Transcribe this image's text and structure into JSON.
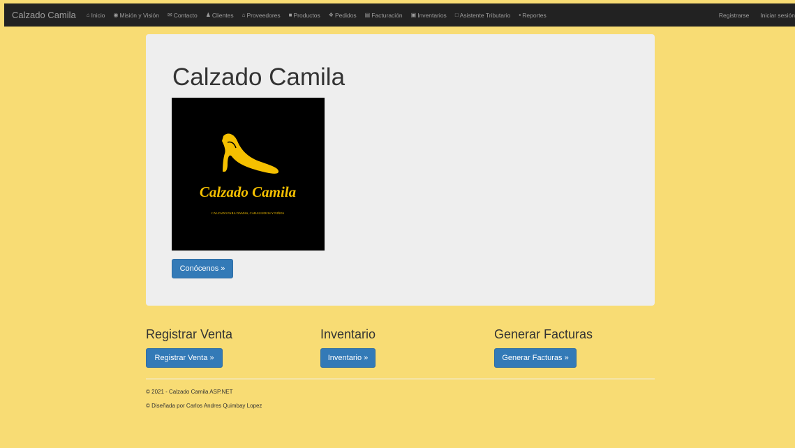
{
  "nav": {
    "brand": "Calzado Camila",
    "items": [
      {
        "label": "Inicio",
        "icon": "home-icon",
        "glyph": "⌂"
      },
      {
        "label": "Misión y Visión",
        "icon": "eye-icon",
        "glyph": "◉"
      },
      {
        "label": "Contacto",
        "icon": "envelope-icon",
        "glyph": "✉"
      },
      {
        "label": "Clientes",
        "icon": "users-icon",
        "glyph": "♟"
      },
      {
        "label": "Proveedores",
        "icon": "bank-icon",
        "glyph": "⌂"
      },
      {
        "label": "Productos",
        "icon": "book-icon",
        "glyph": "■"
      },
      {
        "label": "Pedidos",
        "icon": "cubes-icon",
        "glyph": "❖"
      },
      {
        "label": "Facturación",
        "icon": "cart-icon",
        "glyph": "▤"
      },
      {
        "label": "Inventarios",
        "icon": "list-icon",
        "glyph": "▣"
      },
      {
        "label": "Asistente Tributario",
        "icon": "calendar-icon",
        "glyph": "□"
      },
      {
        "label": "Reportes",
        "icon": "file-icon",
        "glyph": "▪"
      }
    ],
    "register": "Registrarse",
    "login": "Iniciar sesión"
  },
  "jumbotron": {
    "title": "Calzado Camila",
    "logo_text": "Calzado Camila",
    "logo_tagline": "CALZADO PARA DAMAS, CABALLEROS Y NIÑOS",
    "button": "Conócenos »"
  },
  "columns": [
    {
      "heading": "Registrar Venta",
      "button": "Registrar Venta »"
    },
    {
      "heading": "Inventario",
      "button": "Inventario »"
    },
    {
      "heading": "Generar Facturas",
      "button": "Generar Facturas »"
    }
  ],
  "footer": {
    "copyright": "© 2021 - Calzado Camila ASP.NET",
    "credit": "© Diseñada por Carlos Andres Quimbay Lopez"
  },
  "colors": {
    "background": "#f8dc74",
    "navbar": "#222222",
    "jumbotron": "#eeeeee",
    "button": "#337ab7",
    "logo_gold": "#f5c000"
  }
}
